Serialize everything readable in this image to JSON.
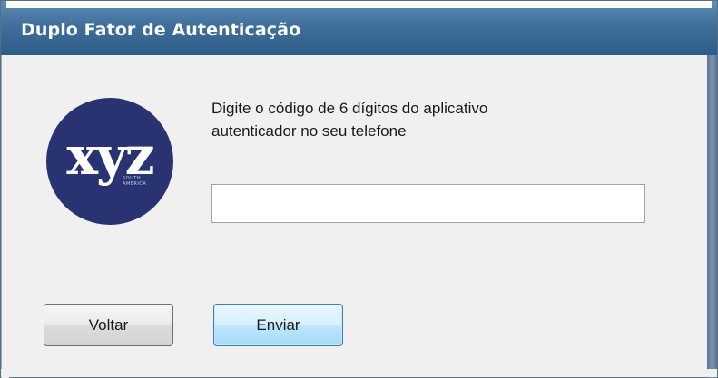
{
  "window": {
    "title": "Duplo Fator de Autenticação"
  },
  "logo": {
    "text": "xyz",
    "subtext_line1": "SOUTH",
    "subtext_line2": "AMERICA"
  },
  "prompt": {
    "line1": "Digite o código de 6 dígitos do aplicativo",
    "line2": "autenticador no seu telefone"
  },
  "code_input": {
    "value": "",
    "placeholder": ""
  },
  "buttons": {
    "back_label": "Voltar",
    "send_label": "Enviar"
  },
  "colors": {
    "titlebar": "#3f6f9b",
    "logo_circle": "#2a3372",
    "send_button_border": "#3c7fb1"
  }
}
